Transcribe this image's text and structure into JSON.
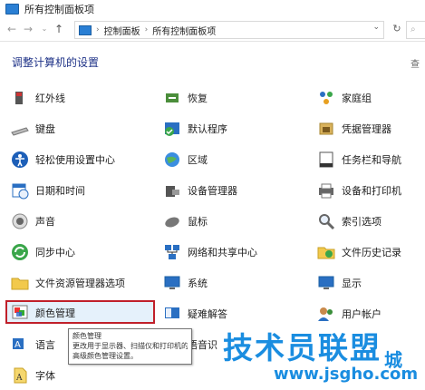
{
  "window": {
    "title": "所有控制面板项"
  },
  "address": {
    "crumbs": [
      "控制面板",
      "所有控制面板项"
    ]
  },
  "heading": "调整计算机的设置",
  "view_label": "查",
  "items": [
    {
      "label": "红外线"
    },
    {
      "label": "恢复"
    },
    {
      "label": "家庭组"
    },
    {
      "label": "键盘"
    },
    {
      "label": "默认程序"
    },
    {
      "label": "凭据管理器"
    },
    {
      "label": "轻松使用设置中心"
    },
    {
      "label": "区域"
    },
    {
      "label": "任务栏和导航"
    },
    {
      "label": "日期和时间"
    },
    {
      "label": "设备管理器"
    },
    {
      "label": "设备和打印机"
    },
    {
      "label": "声音"
    },
    {
      "label": "鼠标"
    },
    {
      "label": "索引选项"
    },
    {
      "label": "同步中心"
    },
    {
      "label": "网络和共享中心"
    },
    {
      "label": "文件历史记录"
    },
    {
      "label": "文件资源管理器选项"
    },
    {
      "label": "系统"
    },
    {
      "label": "显示"
    },
    {
      "label": "颜色管理"
    },
    {
      "label": "疑难解答"
    },
    {
      "label": "用户帐户"
    },
    {
      "label": "语言"
    },
    {
      "label": "语音识"
    },
    {
      "label": "字体"
    }
  ],
  "tooltip": {
    "title": "颜色管理",
    "line1": "更改用于显示器、扫描仪和打印机的",
    "line2": "高级颜色管理设置。"
  },
  "watermark": {
    "main": "技术员联盟",
    "side": "城",
    "url": "www.jsgho.com"
  }
}
